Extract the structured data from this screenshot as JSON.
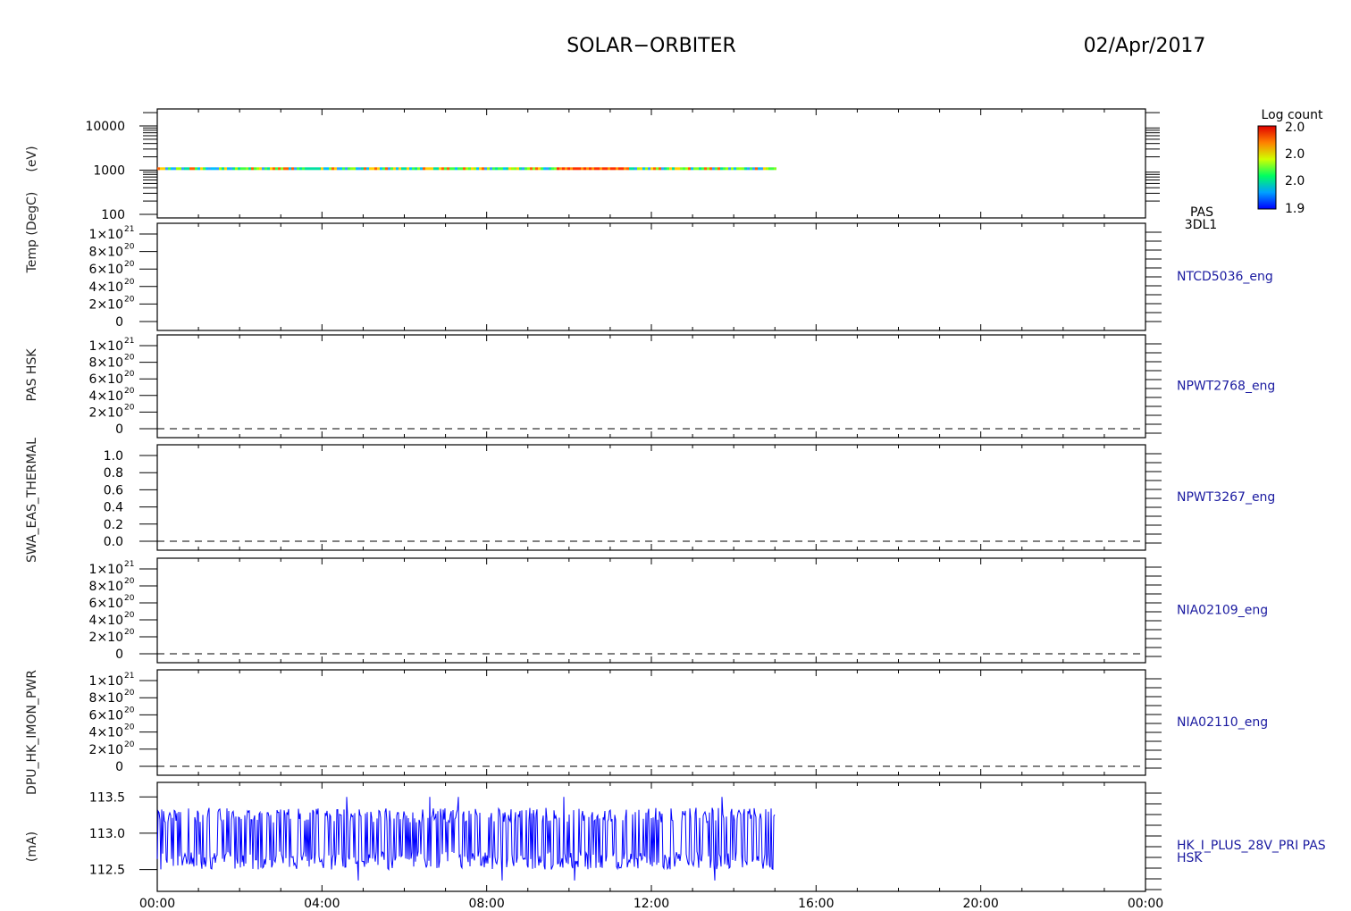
{
  "header": {
    "title": "SOLAR−ORBITER",
    "date": "02/Apr/2017"
  },
  "colorbar": {
    "title": "Log count",
    "ticks": [
      "2.0",
      "2.0",
      "2.0",
      "1.9"
    ]
  },
  "xaxis": {
    "ticks": [
      "00:00",
      "04:00",
      "08:00",
      "12:00",
      "16:00",
      "20:00",
      "00:00"
    ]
  },
  "left_label": "(mA)",
  "left_stacked_labels": [
    "Temp (DegC)",
    "(eV)",
    "SWA_EAS_THERMAL",
    "PAS HSK",
    "DPU_HK_IMON_PWR"
  ],
  "colors": {
    "trace": "#0000ff",
    "label": "#1a1aa0",
    "axis": "#000000"
  },
  "chart_data": [
    {
      "type": "heatmap",
      "name": "PAS 3DL1",
      "right_label": [
        "PAS",
        "3DL1"
      ],
      "ylabel": "(eV)",
      "yscale": "log",
      "ylim": [
        100,
        20000
      ],
      "yticks": [
        "10000",
        "1000",
        "100"
      ],
      "data_band": {
        "y": 1080,
        "x_start_hr": 0,
        "x_end_hr": 15.0
      }
    },
    {
      "type": "line",
      "name": "NTCD5036_eng",
      "right_label": [
        "NTCD5036_eng"
      ],
      "ylim": [
        0,
        1.2e+21
      ],
      "yticks": [
        "1×10",
        "8×10",
        "6×10",
        "4×10",
        "2×10",
        "0"
      ],
      "ytick_exps": [
        "21",
        "20",
        "20",
        "20",
        "20",
        ""
      ],
      "zero_dashed": false
    },
    {
      "type": "line",
      "name": "NPWT2768_eng",
      "right_label": [
        "NPWT2768_eng"
      ],
      "ylim": [
        0,
        1.2e+21
      ],
      "yticks": [
        "1×10",
        "8×10",
        "6×10",
        "4×10",
        "2×10",
        "0"
      ],
      "ytick_exps": [
        "21",
        "20",
        "20",
        "20",
        "20",
        ""
      ],
      "zero_dashed": true
    },
    {
      "type": "line",
      "name": "NPWT3267_eng",
      "right_label": [
        "NPWT3267_eng"
      ],
      "ylim": [
        0,
        1.0
      ],
      "yticks": [
        "1.0",
        "0.8",
        "0.6",
        "0.4",
        "0.2",
        "0.0"
      ],
      "ytick_exps": [
        "",
        "",
        "",
        "",
        "",
        ""
      ],
      "zero_dashed": true
    },
    {
      "type": "line",
      "name": "NIA02109_eng",
      "right_label": [
        "NIA02109_eng"
      ],
      "ylim": [
        0,
        1.2e+21
      ],
      "yticks": [
        "1×10",
        "8×10",
        "6×10",
        "4×10",
        "2×10",
        "0"
      ],
      "ytick_exps": [
        "21",
        "20",
        "20",
        "20",
        "20",
        ""
      ],
      "zero_dashed": true
    },
    {
      "type": "line",
      "name": "NIA02110_eng",
      "right_label": [
        "NIA02110_eng"
      ],
      "ylim": [
        0,
        1.2e+21
      ],
      "yticks": [
        "1×10",
        "8×10",
        "6×10",
        "4×10",
        "2×10",
        "0"
      ],
      "ytick_exps": [
        "21",
        "20",
        "20",
        "20",
        "20",
        ""
      ],
      "zero_dashed": true
    },
    {
      "type": "line",
      "name": "HK_I_PLUS_28V_PRI PAS HSK",
      "right_label": [
        "HK_I_PLUS_28V_PRI PAS",
        "HSK"
      ],
      "ylabel": "(mA)",
      "ylim": [
        112.2,
        113.7
      ],
      "yticks": [
        "113.5",
        "113.0",
        "112.5"
      ],
      "x_start_hr": 0,
      "x_end_hr": 15.0,
      "mean": 112.92,
      "min": 112.35,
      "max": 113.5
    }
  ]
}
